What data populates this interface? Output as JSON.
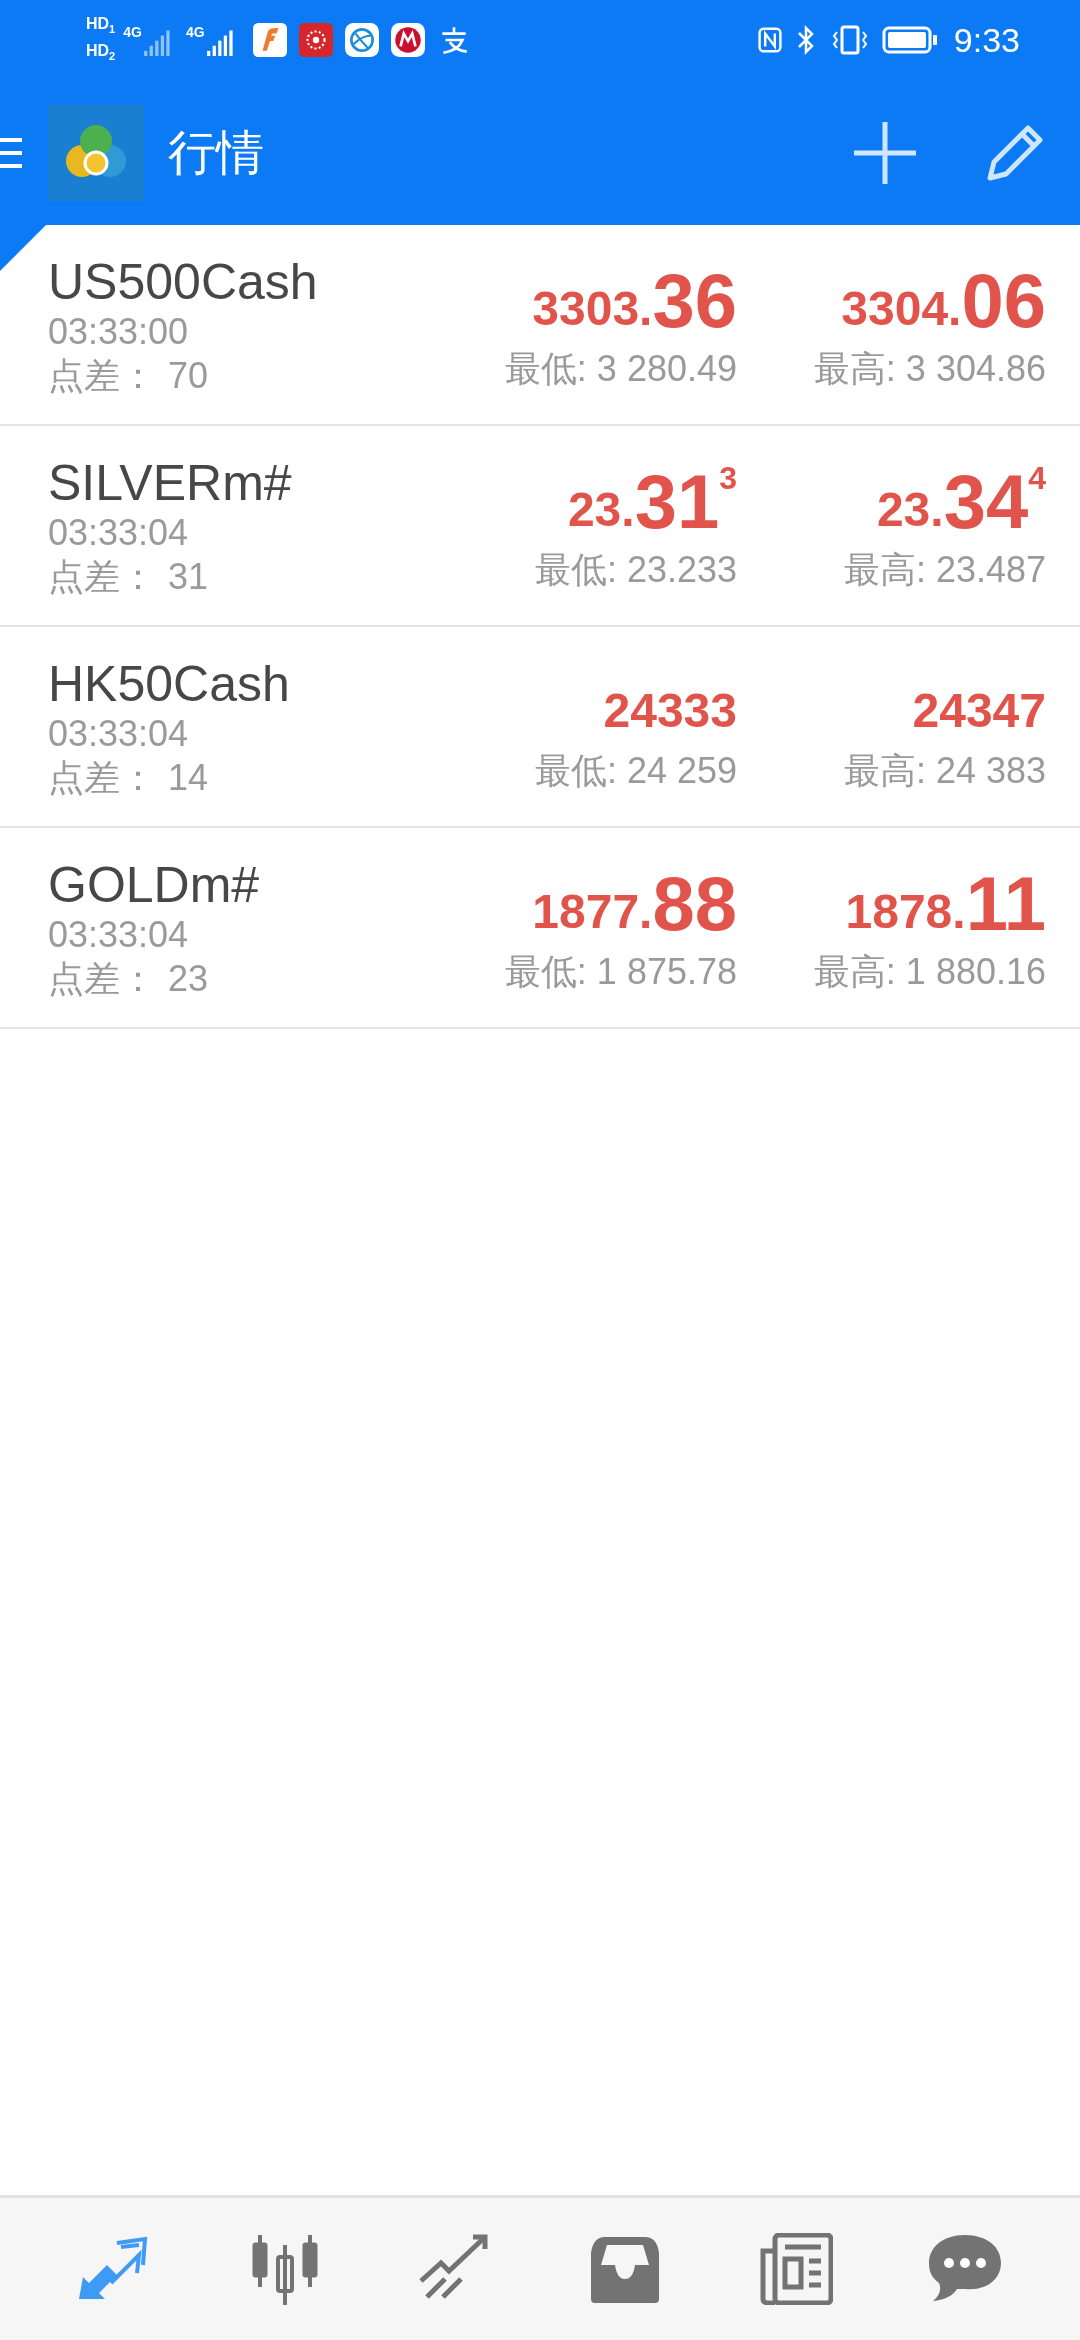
{
  "status_bar": {
    "sims": [
      {
        "badge": "HD",
        "slot": "1",
        "network": "4G"
      },
      {
        "badge": "HD",
        "slot": "2",
        "network": "4G"
      }
    ],
    "time": "9:33"
  },
  "header": {
    "title": "行情"
  },
  "quotes": [
    {
      "symbol": "US500Cash",
      "time": "03:33:00",
      "spread_label": "点差：",
      "spread": "70",
      "selected": true,
      "bid": {
        "small": "3303.",
        "big": "36"
      },
      "ask": {
        "small": "3304.",
        "big": "06"
      },
      "low": "最低: 3 280.49",
      "high": "最高: 3 304.86"
    },
    {
      "symbol": "SILVERm#",
      "time": "03:33:04",
      "spread_label": "点差：",
      "spread": "31",
      "selected": false,
      "bid": {
        "small": "23.",
        "big": "31",
        "sup": "3"
      },
      "ask": {
        "small": "23.",
        "big": "34",
        "sup": "4"
      },
      "low": "最低: 23.233",
      "high": "最高: 23.487"
    },
    {
      "symbol": "HK50Cash",
      "time": "03:33:04",
      "spread_label": "点差：",
      "spread": "14",
      "selected": false,
      "bid": {
        "small": "24333"
      },
      "ask": {
        "small": "24347"
      },
      "low": "最低: 24 259",
      "high": "最高: 24 383"
    },
    {
      "symbol": "GOLDm#",
      "time": "03:33:04",
      "spread_label": "点差：",
      "spread": "23",
      "selected": false,
      "bid": {
        "small": "1877.",
        "big": "88"
      },
      "ask": {
        "small": "1878.",
        "big": "11"
      },
      "low": "最低: 1 875.78",
      "high": "最高: 1 880.16"
    }
  ],
  "bottom_nav": [
    {
      "kind": "quotes",
      "selected": true
    },
    {
      "kind": "chart",
      "selected": false
    },
    {
      "kind": "trade",
      "selected": false
    },
    {
      "kind": "history",
      "selected": false
    },
    {
      "kind": "news",
      "selected": false
    },
    {
      "kind": "chat",
      "selected": false
    }
  ]
}
